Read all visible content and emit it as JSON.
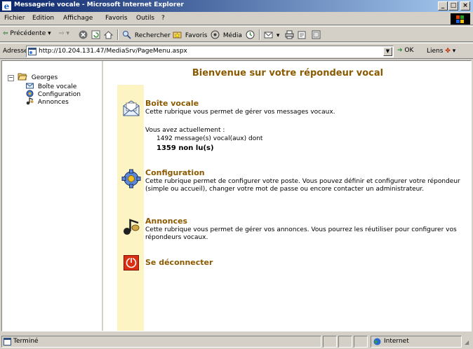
{
  "window": {
    "title": "Messagerie vocale - Microsoft Internet Explorer",
    "buttons": {
      "minimize": "_",
      "maximize": "□",
      "close": "×"
    }
  },
  "menu": {
    "file": "Fichier",
    "edit": "Edition",
    "view": "Affichage",
    "favorites": "Favoris",
    "tools": "Outils",
    "help": "?"
  },
  "toolbar": {
    "back": "Précédente",
    "search": "Rechercher",
    "favorites": "Favoris",
    "media": "Média"
  },
  "address": {
    "label": "Adresse",
    "url": "http://10.204.131.47/MediaSrv/PageMenu.aspx",
    "go": "OK",
    "links": "Liens"
  },
  "tree": {
    "root": "Georges",
    "items": [
      "Boîte vocale",
      "Configuration",
      "Annonces"
    ]
  },
  "main": {
    "title": "Bienvenue sur votre répondeur vocal",
    "voicemail": {
      "title": "Boîte vocale",
      "desc": "Cette rubrique vous permet de gérer vos messages vocaux.",
      "intro": "Vous avez actuellement :",
      "count_line": "1492 message(s) vocal(aux) dont",
      "unread_line": "1359 non lu(s)"
    },
    "configuration": {
      "title": "Configuration",
      "desc": "Cette rubrique permet de configurer votre poste. Vous pouvez définir et configurer votre répondeur (simple ou accueil), changer votre mot de passe ou encore contacter un administrateur."
    },
    "announcements": {
      "title": "Annonces",
      "desc": "Cette rubrique vous permet de gérer vos annonces. Vous pourrez les réutiliser pour configurer vos répondeurs vocaux."
    },
    "logout": {
      "title": "Se déconnecter"
    }
  },
  "status": {
    "text": "Terminé",
    "zone": "Internet"
  },
  "colors": {
    "accent": "#8b5a00",
    "stripe": "#fdf4c4",
    "titlebar": "#0a246a"
  }
}
